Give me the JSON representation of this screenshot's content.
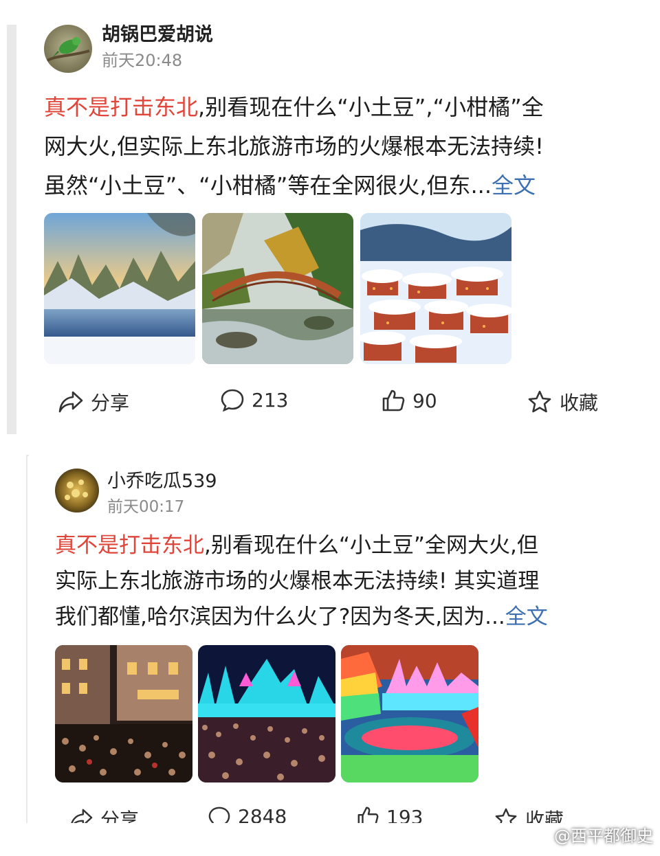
{
  "posts": [
    {
      "author": "胡锅巴爱胡说",
      "time": "前天20:48",
      "highlight": "真不是打击东北",
      "line1_rest": ",别看现在什么“小土豆”,“小柑橘”全",
      "line2": "网大火,但实际上东北旅游市场的火爆根本无法持续!",
      "line3": "虽然“小土豆”、“小柑橘”等在全网很火,但东...",
      "more": "全文",
      "images": [
        "snowy-lake-forest",
        "wooden-bridge-autumn-river",
        "snow-village-lights"
      ],
      "share_label": "分享",
      "comments": "213",
      "likes": "90",
      "favorite_label": "收藏"
    },
    {
      "author": "小乔吃瓜539",
      "time": "前天00:17",
      "highlight": "真不是打击东北",
      "line1_rest": ",别看现在什么“小土豆”全网大火,但",
      "line2": "实际上东北旅游市场的火爆根本无法持续! 其实道理",
      "line3": "我们都懂,哈尔滨因为什么火了?因为冬天,因为...",
      "more": "全文",
      "images": [
        "crowded-street-night",
        "ice-festival-crowd",
        "ice-world-light-show"
      ],
      "share_label": "分享",
      "comments": "2848",
      "likes": "193",
      "favorite_label": "收藏"
    }
  ],
  "watermark": "@西平都御史",
  "icons": {
    "share": "share-icon",
    "comment": "comment-icon",
    "like": "thumbs-up-icon",
    "favorite": "star-icon",
    "watermark": "weibo-logo-icon"
  }
}
